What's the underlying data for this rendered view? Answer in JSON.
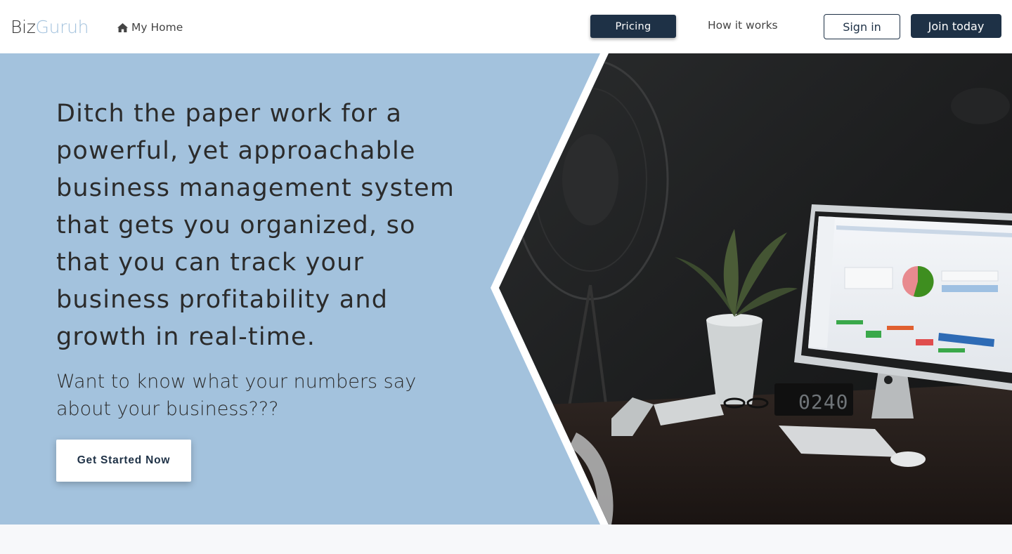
{
  "nav": {
    "brand_part1": "Biz",
    "brand_part2": "Guruh",
    "home_label": "My Home",
    "pricing_label": "Pricing",
    "how_label": "How it works",
    "signin_label": "Sign in",
    "join_label": "Join today"
  },
  "hero": {
    "headline": "Ditch the paper work for a powerful, yet approachable business management system that gets you organized, so that you can track your business profitability and growth in real-time.",
    "subline": "Want to know what your numbers say about your business???",
    "cta_label": "Get Started Now",
    "clock_text": "02:40"
  },
  "colors": {
    "brand_accent": "#a3c2dd",
    "navy": "#1e3146",
    "hero_bg": "#a3c2dd"
  },
  "icons": {
    "home": "home-icon"
  }
}
